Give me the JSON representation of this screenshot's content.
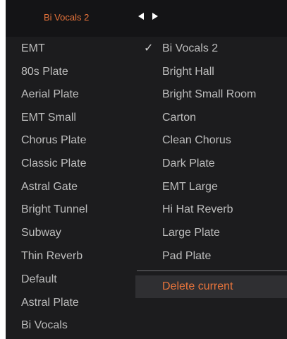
{
  "header": {
    "current_preset": "Bi Vocals 2",
    "prev_icon": "triangle-left-icon",
    "next_icon": "triangle-right-icon"
  },
  "column_left": [
    "EMT",
    "80s Plate",
    "Aerial Plate",
    "EMT Small",
    "Chorus Plate",
    "Classic Plate",
    "Astral Gate",
    "Bright Tunnel",
    "Subway",
    "Thin Reverb",
    "Default",
    "Astral Plate",
    "Bi Vocals"
  ],
  "column_right": [
    "Bi Vocals 2",
    "Bright Hall",
    "Bright Small Room",
    "Carton",
    "Clean Chorus",
    "Dark Plate",
    "EMT Large",
    "Hi Hat Reverb",
    "Large Plate",
    "Pad Plate"
  ],
  "selected_mark": "✓",
  "delete_label": "Delete current",
  "colors": {
    "accent": "#e8743b",
    "background": "#1c1c1e",
    "text": "#bdbdbd"
  }
}
